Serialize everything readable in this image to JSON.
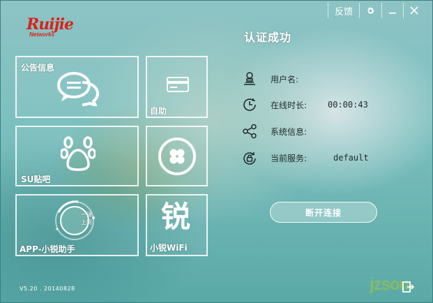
{
  "titlebar": {
    "feedback_label": "反馈",
    "settings_icon": "gear-icon",
    "minimize_icon": "minimize-icon",
    "close_icon": "close-icon"
  },
  "logo": {
    "main": "Ruijie",
    "sub": "Networks"
  },
  "tiles": {
    "announcement": {
      "label": "公告信息",
      "icon": "chat-bubbles-icon"
    },
    "self_service": {
      "label": "自助",
      "icon": "card-icon"
    },
    "su_tieba": {
      "label": "SU贴吧",
      "icon": "paw-icon"
    },
    "clover": {
      "label": "",
      "icon": "clover-icon"
    },
    "app_assistant": {
      "label": "APP-小锐助手",
      "icon": "one-click-net-icon",
      "badge_line1": "一键",
      "badge_line2": "上网"
    },
    "wifi": {
      "label": "小锐WiFi",
      "icon": "rui-char-icon",
      "glyph": "锐"
    }
  },
  "status": {
    "title": "认证成功",
    "rows": [
      {
        "icon": "user-icon",
        "label": "用户名:",
        "value": ""
      },
      {
        "icon": "clock-icon",
        "label": "在线时长:",
        "value": "00:00:43"
      },
      {
        "icon": "share-icon",
        "label": "系统信息:",
        "value": ""
      },
      {
        "icon": "service-lock-icon",
        "label": "当前服务:",
        "value": "default"
      }
    ],
    "disconnect_label": "断开连接"
  },
  "footer": {
    "version": "V5.20 . 20140828",
    "exit_icon": "exit-icon",
    "watermark": "jzsou"
  },
  "colors": {
    "brand_red": "#d8231d",
    "background": "#7cc0bf",
    "tile_border": "#ffffff"
  }
}
